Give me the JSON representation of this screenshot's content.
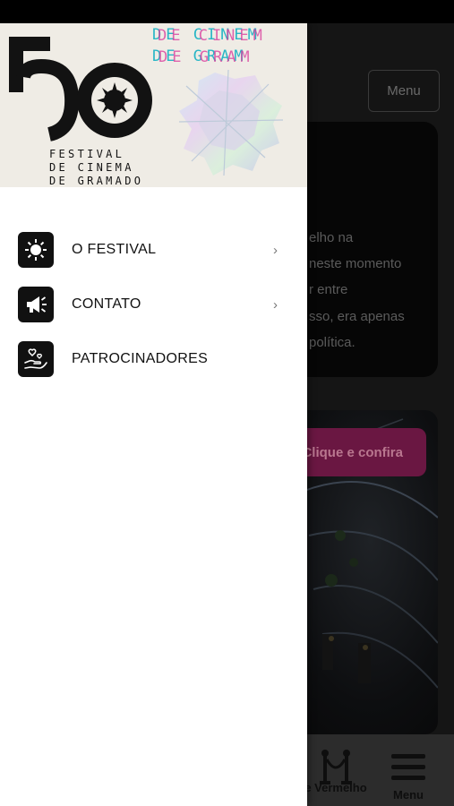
{
  "background": {
    "menu_button_label": "Menu",
    "card_lines": [
      "elho na",
      "neste momento",
      "r entre",
      "sso, era apenas",
      "política."
    ],
    "cta_label": "Clique e confira",
    "bottom_nav": [
      {
        "label": "e Vermelho",
        "icon": "red-carpet-icon"
      },
      {
        "label": "Menu",
        "icon": "hamburger-icon"
      }
    ]
  },
  "drawer": {
    "logo": {
      "number": "50",
      "caption_lines": [
        "FESTIVAL",
        "DE CINEMA",
        "DE GRAMADO"
      ],
      "glitch_line_1": "DE CINEM",
      "glitch_line_2": "DE GRAM"
    },
    "menu_items": [
      {
        "label": "O FESTIVAL",
        "icon": "festival-sun-icon",
        "has_submenu": true
      },
      {
        "label": "CONTATO",
        "icon": "megaphone-icon",
        "has_submenu": true
      },
      {
        "label": "PATROCINADORES",
        "icon": "hand-hearts-icon",
        "has_submenu": false
      }
    ],
    "chevron_glyph": "›"
  },
  "colors": {
    "accent": "#6a1742",
    "drawer_header_bg": "#efece5",
    "icon_tile_bg": "#111111"
  }
}
